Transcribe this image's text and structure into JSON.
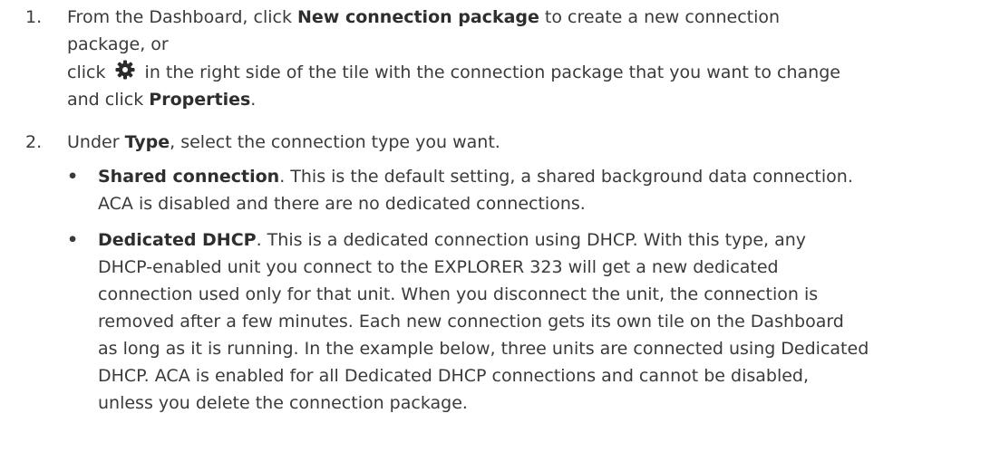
{
  "steps": [
    {
      "number": "1.",
      "line1_prefix": "From the Dashboard, click ",
      "line1_bold": "New connection package",
      "line1_suffix": " to create a new connection",
      "line2": "package, or",
      "line3_prefix": "click ",
      "line3_suffix": " in the right side of the tile with the connection package that you want to change",
      "line4_prefix": "and click ",
      "line4_bold": "Properties",
      "line4_suffix": "."
    },
    {
      "number": "2.",
      "prefix": "Under ",
      "bold": "Type",
      "suffix": ", select the connection type you want."
    }
  ],
  "bullets": [
    {
      "marker": "•",
      "title": "Shared connection",
      "lines": [
        ". This is the default setting, a shared background data connection.",
        "ACA is disabled and there are no dedicated connections."
      ]
    },
    {
      "marker": "•",
      "title": "Dedicated DHCP",
      "lines": [
        ". This is a dedicated connection using DHCP. With this type, any",
        "DHCP-enabled unit you connect to the EXPLORER 323 will get a new dedicated",
        "connection used only for that unit. When you disconnect the unit, the connection is",
        "removed after a few minutes. Each new connection gets its own tile on the Dashboard",
        "as long as it is running. In the example below, three units are connected using Dedicated",
        "DHCP. ACA is enabled for all Dedicated DHCP connections and cannot be disabled,",
        "unless you delete the connection package."
      ]
    }
  ],
  "icons": {
    "settings": "gear-icon",
    "color": "#2b2b2b"
  }
}
